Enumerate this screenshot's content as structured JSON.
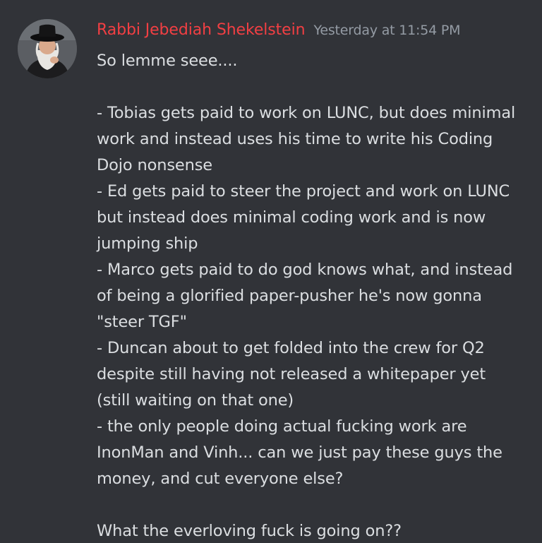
{
  "message": {
    "author": "Rabbi Jebediah Shekelstein",
    "timestamp": "Yesterday at 11:54 PM",
    "author_color": "#f23f43",
    "lines": [
      "So lemme seee....",
      "",
      "- Tobias gets paid to work on LUNC, but does minimal",
      "work and instead uses his time to write his Coding",
      "Dojo nonsense",
      "- Ed gets paid to steer the project and work on LUNC",
      "but instead does minimal coding work and is now",
      "jumping ship",
      "- Marco gets paid to do god knows what, and instead",
      "of being a glorified paper-pusher he's now gonna",
      "\"steer TGF\"",
      "- Duncan about to get folded into the crew for Q2",
      "despite still having not released a whitepaper yet",
      "(still waiting on that one)",
      "- the only people doing actual fucking work are",
      "InonMan and Vinh... can we just pay these guys the",
      "money, and cut everyone else?",
      "",
      "What the everloving fuck is going on??"
    ]
  },
  "colors": {
    "background": "#313338",
    "text": "#dbdee1",
    "muted": "#949ba4"
  }
}
